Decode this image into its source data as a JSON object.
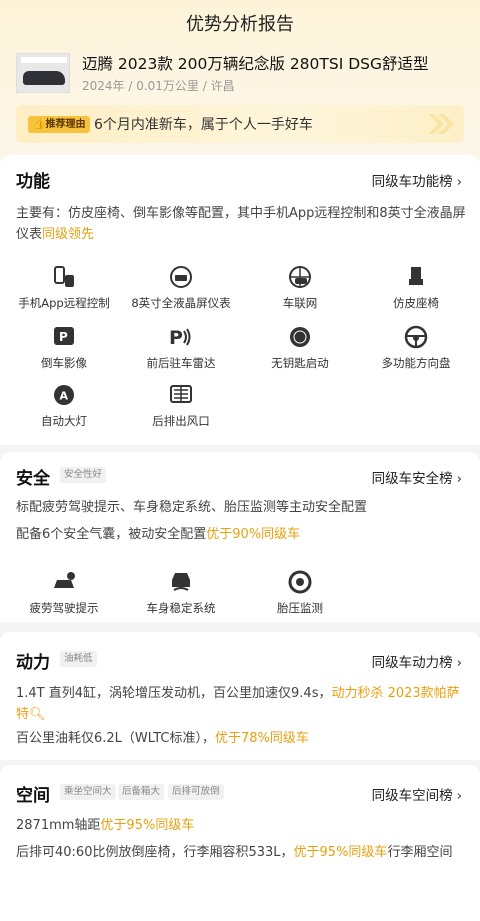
{
  "page": {
    "title": "优势分析报告"
  },
  "car": {
    "name": "迈腾 2023款 200万辆纪念版 280TSI DSG舒适型",
    "meta": "2024年 / 0.01万公里 / 许昌",
    "reason_tag": "推荐理由",
    "reason_text": "6个月内准新车，属于个人一手好车"
  },
  "function": {
    "title": "功能",
    "rank": "同级车功能榜",
    "desc": "主要有：仿皮座椅、倒车影像等配置，其中手机App远程控制和8英寸全液晶屏仪表",
    "desc_hl": "同级领先",
    "items": [
      {
        "label": "手机App远程控制",
        "icon": "phone-app-icon"
      },
      {
        "label": "8英寸全液晶屏仪表",
        "icon": "lcd-dashboard-icon"
      },
      {
        "label": "车联网",
        "icon": "connected-car-icon"
      },
      {
        "label": "仿皮座椅",
        "icon": "seat-icon"
      },
      {
        "label": "倒车影像",
        "icon": "reverse-camera-icon"
      },
      {
        "label": "前后驻车雷达",
        "icon": "parking-radar-icon"
      },
      {
        "label": "无钥匙启动",
        "icon": "keyless-start-icon"
      },
      {
        "label": "多功能方向盘",
        "icon": "steering-wheel-icon"
      },
      {
        "label": "自动大灯",
        "icon": "auto-headlight-icon"
      },
      {
        "label": "后排出风口",
        "icon": "rear-vent-icon"
      }
    ]
  },
  "safety": {
    "title": "安全",
    "tag": "安全性好",
    "rank": "同级车安全榜",
    "line1": "标配疲劳驾驶提示、车身稳定系统、胎压监测等主动安全配置",
    "line2": "配备6个安全气囊，被动安全配置",
    "line2_hl": "优于90%同级车",
    "items": [
      {
        "label": "疲劳驾驶提示",
        "icon": "fatigue-alert-icon"
      },
      {
        "label": "车身稳定系统",
        "icon": "stability-system-icon"
      },
      {
        "label": "胎压监测",
        "icon": "tire-pressure-icon"
      }
    ]
  },
  "power": {
    "title": "动力",
    "tag": "油耗低",
    "rank": "同级车动力榜",
    "line1": "1.4T 直列4缸，涡轮增压发动机，百公里加速仅9.4s，",
    "line1_hl": "动力秒杀 2023款帕萨特",
    "line2": "百公里油耗仅6.2L（WLTC标准），",
    "line2_hl": "优于78%同级车"
  },
  "space": {
    "title": "空间",
    "tags": [
      "乘坐空间大",
      "后备箱大",
      "后排可放倒"
    ],
    "rank": "同级车空间榜",
    "line1": "2871mm轴距",
    "line1_hl": "优于95%同级车",
    "line2": "后排可40:60比例放倒座椅，行李厢容积533L，",
    "line2_hl": "优于95%同级车",
    "line2_tail": "行李厢空间"
  },
  "colors": {
    "accent": "#e9a00f",
    "tag_bg": "#f7c23c",
    "icon": "#3a3a3a"
  }
}
